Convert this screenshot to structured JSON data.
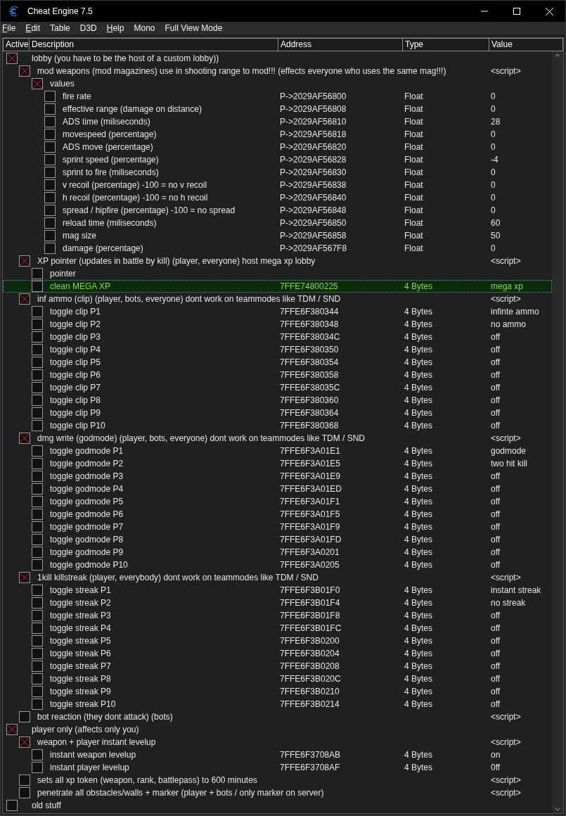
{
  "window": {
    "title": "Cheat Engine 7.5"
  },
  "menu": [
    {
      "label": "File",
      "mnemonic": true
    },
    {
      "label": "Edit",
      "mnemonic": true
    },
    {
      "label": "Table",
      "mnemonic": false
    },
    {
      "label": "D3D",
      "mnemonic": false
    },
    {
      "label": "Help",
      "mnemonic": true
    },
    {
      "label": "Mono",
      "mnemonic": false
    },
    {
      "label": "Full View Mode",
      "mnemonic": false
    }
  ],
  "table": {
    "columns": [
      "Active",
      "Description",
      "Address",
      "Type",
      "Value"
    ],
    "rows": [
      {
        "description": "lobby  (you have to be the host of a custom lobby))",
        "checked": true,
        "selected": false,
        "children": [
          {
            "description": "mod weapons (mod magazines) use in shooting range to mod!!! (effects everyone who uses the same mag!!!)",
            "value": "<script>",
            "checked": true,
            "selected": false,
            "children": [
              {
                "description": "values",
                "checked": true,
                "selected": false,
                "children": [
                  {
                    "description": "fire rate",
                    "address": "P->2029AF56800",
                    "type": "Float",
                    "value": "0",
                    "checked": false,
                    "selected": false
                  },
                  {
                    "description": "effective range (damage on distance)",
                    "address": "P->2029AF56808",
                    "type": "Float",
                    "value": "0",
                    "checked": false,
                    "selected": false
                  },
                  {
                    "description": "ADS time (miliseconds)",
                    "address": "P->2029AF56810",
                    "type": "Float",
                    "value": "28",
                    "checked": false,
                    "selected": false
                  },
                  {
                    "description": "movespeed (percentage)",
                    "address": "P->2029AF56818",
                    "type": "Float",
                    "value": "0",
                    "checked": false,
                    "selected": false
                  },
                  {
                    "description": "ADS move (percentage)",
                    "address": "P->2029AF56820",
                    "type": "Float",
                    "value": "0",
                    "checked": false,
                    "selected": false
                  },
                  {
                    "description": "sprint speed (percentage)",
                    "address": "P->2029AF56828",
                    "type": "Float",
                    "value": "-4",
                    "checked": false,
                    "selected": false
                  },
                  {
                    "description": "sprint to fire (miliseconds)",
                    "address": "P->2029AF56830",
                    "type": "Float",
                    "value": "0",
                    "checked": false,
                    "selected": false
                  },
                  {
                    "description": "v recoil (percentage) -100 = no v recoil",
                    "address": "P->2029AF56838",
                    "type": "Float",
                    "value": "0",
                    "checked": false,
                    "selected": false
                  },
                  {
                    "description": "h recoil (percentage) -100 = no h recoil",
                    "address": "P->2029AF56840",
                    "type": "Float",
                    "value": "0",
                    "checked": false,
                    "selected": false
                  },
                  {
                    "description": "spread / hipfire (percentage) -100 = no spread",
                    "address": "P->2029AF56848",
                    "type": "Float",
                    "value": "0",
                    "checked": false,
                    "selected": false
                  },
                  {
                    "description": "reload time (miliseconds)",
                    "address": "P->2029AF56850",
                    "type": "Float",
                    "value": "60",
                    "checked": false,
                    "selected": false
                  },
                  {
                    "description": "mag size",
                    "address": "P->2029AF56858",
                    "type": "Float",
                    "value": "50",
                    "checked": false,
                    "selected": false
                  },
                  {
                    "description": "damage (percentage)",
                    "address": "P->2029AF567F8",
                    "type": "Float",
                    "value": "0",
                    "checked": false,
                    "selected": false
                  }
                ]
              }
            ]
          },
          {
            "description": "XP pointer (updates in battle by kill) (player, everyone) host mega xp lobby",
            "value": "<script>",
            "checked": true,
            "selected": false,
            "children": [
              {
                "description": "pointer",
                "checked": false,
                "selected": false
              },
              {
                "description": "clean MEGA XP",
                "address": "7FFE74800225",
                "type": "4 Bytes",
                "value": "mega xp",
                "checked": false,
                "selected": true
              }
            ]
          },
          {
            "description": "inf ammo (clip) (player, bots, everyone) dont work on teammodes like TDM / SND",
            "value": "<script>",
            "checked": true,
            "selected": false,
            "children": [
              {
                "description": "toggle clip P1",
                "address": "7FFE6F380344",
                "type": "4 Bytes",
                "value": "infinte ammo",
                "checked": false,
                "selected": false
              },
              {
                "description": "toggle clip P2",
                "address": "7FFE6F380348",
                "type": "4 Bytes",
                "value": "no ammo",
                "checked": false,
                "selected": false
              },
              {
                "description": "toggle clip P3",
                "address": "7FFE6F38034C",
                "type": "4 Bytes",
                "value": "off",
                "checked": false,
                "selected": false
              },
              {
                "description": "toggle clip P4",
                "address": "7FFE6F380350",
                "type": "4 Bytes",
                "value": "off",
                "checked": false,
                "selected": false
              },
              {
                "description": "toggle clip P5",
                "address": "7FFE6F380354",
                "type": "4 Bytes",
                "value": "off",
                "checked": false,
                "selected": false
              },
              {
                "description": "toggle clip P6",
                "address": "7FFE6F380358",
                "type": "4 Bytes",
                "value": "off",
                "checked": false,
                "selected": false
              },
              {
                "description": "toggle clip P7",
                "address": "7FFE6F38035C",
                "type": "4 Bytes",
                "value": "off",
                "checked": false,
                "selected": false
              },
              {
                "description": "toggle clip P8",
                "address": "7FFE6F380360",
                "type": "4 Bytes",
                "value": "off",
                "checked": false,
                "selected": false
              },
              {
                "description": "toggle clip P9",
                "address": "7FFE6F380364",
                "type": "4 Bytes",
                "value": "off",
                "checked": false,
                "selected": false
              },
              {
                "description": "toggle clip P10",
                "address": "7FFE6F380368",
                "type": "4 Bytes",
                "value": "off",
                "checked": false,
                "selected": false
              }
            ]
          },
          {
            "description": "dmg write (godmode) (player, bots, everyone) dont work on teammodes like TDM / SND",
            "value": "<script>",
            "checked": true,
            "selected": false,
            "children": [
              {
                "description": "toggle godmode P1",
                "address": "7FFE6F3A01E1",
                "type": "4 Bytes",
                "value": "godmode",
                "checked": false,
                "selected": false
              },
              {
                "description": "toggle godmode P2",
                "address": "7FFE6F3A01E5",
                "type": "4 Bytes",
                "value": "two hit kill",
                "checked": false,
                "selected": false
              },
              {
                "description": "toggle godmode P3",
                "address": "7FFE6F3A01E9",
                "type": "4 Bytes",
                "value": "off",
                "checked": false,
                "selected": false
              },
              {
                "description": "toggle godmode P4",
                "address": "7FFE6F3A01ED",
                "type": "4 Bytes",
                "value": "off",
                "checked": false,
                "selected": false
              },
              {
                "description": "toggle godmode P5",
                "address": "7FFE6F3A01F1",
                "type": "4 Bytes",
                "value": "off",
                "checked": false,
                "selected": false
              },
              {
                "description": "toggle godmode P6",
                "address": "7FFE6F3A01F5",
                "type": "4 Bytes",
                "value": "off",
                "checked": false,
                "selected": false
              },
              {
                "description": "toggle godmode P7",
                "address": "7FFE6F3A01F9",
                "type": "4 Bytes",
                "value": "off",
                "checked": false,
                "selected": false
              },
              {
                "description": "toggle godmode P8",
                "address": "7FFE6F3A01FD",
                "type": "4 Bytes",
                "value": "off",
                "checked": false,
                "selected": false
              },
              {
                "description": "toggle godmode P9",
                "address": "7FFE6F3A0201",
                "type": "4 Bytes",
                "value": "off",
                "checked": false,
                "selected": false
              },
              {
                "description": "toggle godmode P10",
                "address": "7FFE6F3A0205",
                "type": "4 Bytes",
                "value": "off",
                "checked": false,
                "selected": false
              }
            ]
          },
          {
            "description": "1kill killstreak (player, everybody) dont work on teammodes like TDM / SND",
            "value": "<script>",
            "checked": true,
            "selected": false,
            "children": [
              {
                "description": "toggle streak P1",
                "address": "7FFE6F3B01F0",
                "type": "4 Bytes",
                "value": "instant streak",
                "checked": false,
                "selected": false
              },
              {
                "description": "toggle streak P2",
                "address": "7FFE6F3B01F4",
                "type": "4 Bytes",
                "value": "no streak",
                "checked": false,
                "selected": false
              },
              {
                "description": "toggle streak P3",
                "address": "7FFE6F3B01F8",
                "type": "4 Bytes",
                "value": "off",
                "checked": false,
                "selected": false
              },
              {
                "description": "toggle streak P4",
                "address": "7FFE6F3B01FC",
                "type": "4 Bytes",
                "value": "off",
                "checked": false,
                "selected": false
              },
              {
                "description": "toggle streak P5",
                "address": "7FFE6F3B0200",
                "type": "4 Bytes",
                "value": "off",
                "checked": false,
                "selected": false
              },
              {
                "description": "toggle streak P6",
                "address": "7FFE6F3B0204",
                "type": "4 Bytes",
                "value": "off",
                "checked": false,
                "selected": false
              },
              {
                "description": "toggle streak P7",
                "address": "7FFE6F3B0208",
                "type": "4 Bytes",
                "value": "off",
                "checked": false,
                "selected": false
              },
              {
                "description": "toggle streak P8",
                "address": "7FFE6F3B020C",
                "type": "4 Bytes",
                "value": "off",
                "checked": false,
                "selected": false
              },
              {
                "description": "toggle streak P9",
                "address": "7FFE6F3B0210",
                "type": "4 Bytes",
                "value": "off",
                "checked": false,
                "selected": false
              },
              {
                "description": "toggle streak P10",
                "address": "7FFE6F3B0214",
                "type": "4 Bytes",
                "value": "off",
                "checked": false,
                "selected": false
              }
            ]
          },
          {
            "description": "bot reaction (they dont attack) (bots)",
            "value": "<script>",
            "checked": false,
            "selected": false
          }
        ]
      },
      {
        "description": "player only (affects only you)",
        "checked": true,
        "selected": false,
        "children": [
          {
            "description": "weapon + player instant levelup",
            "value": "<script>",
            "checked": true,
            "selected": false,
            "children": [
              {
                "description": "instant weapon levelup",
                "address": "7FFE6F3708AB",
                "type": "4 Bytes",
                "value": "on",
                "checked": false,
                "selected": false
              },
              {
                "description": "instant player levelup",
                "address": "7FFE6F3708AF",
                "type": "4 Bytes",
                "value": "0ff",
                "checked": false,
                "selected": false
              }
            ]
          },
          {
            "description": "sets all xp token (weapon, rank, battlepass) to 600 minutes",
            "value": "<script>",
            "checked": false,
            "selected": false
          },
          {
            "description": "penetrate all obstacles/walls + marker (player + bots / only marker on server)",
            "value": "<script>",
            "checked": false,
            "selected": false
          }
        ]
      },
      {
        "description": "old stuff",
        "checked": false,
        "selected": false
      }
    ]
  }
}
